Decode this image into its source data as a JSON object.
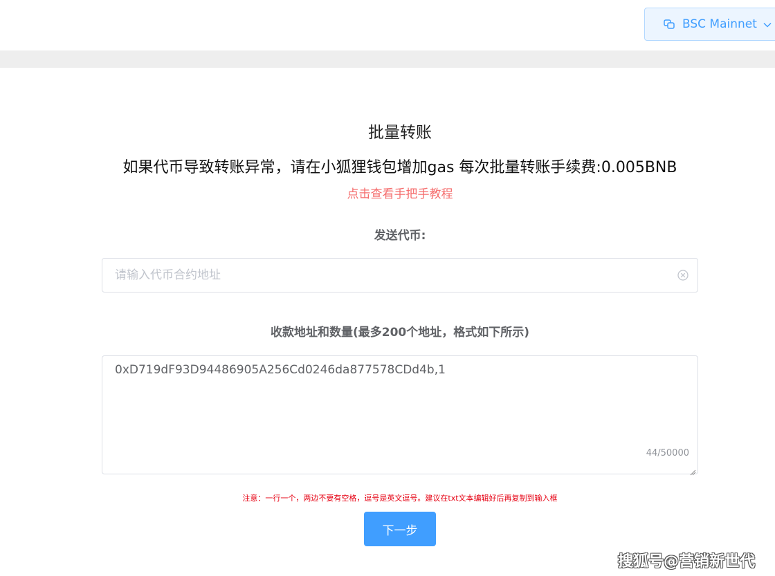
{
  "header": {
    "network_label": "BSC Mainnet",
    "network_icon": "link-icon",
    "dropdown_icon": "chevron-down-icon"
  },
  "main": {
    "title": "批量转账",
    "notice": "如果代币导致转账异常，请在小狐狸钱包增加gas 每次批量转账手续费:0.005BNB",
    "tutorial_link": "点击查看手把手教程",
    "send_token_label": "发送代币:",
    "token_input": {
      "placeholder": "请输入代币合约地址",
      "value": ""
    },
    "recipients_label": "收款地址和数量(最多200个地址，格式如下所示)",
    "recipients_textarea": {
      "value": "0xD719dF93D94486905A256Cd0246da877578CDd4b,1",
      "count": "44/50000"
    },
    "warning": "注意：一行一个，两边不要有空格，逗号是英文逗号。建议在txt文本编辑好后再复制到输入框",
    "next_button": "下一步"
  },
  "watermark": "搜狐号@营销新世代",
  "colors": {
    "primary": "#409eff",
    "link_red": "#f56c6c",
    "warning_red": "#e60012",
    "band_gray": "#eeeeee"
  }
}
